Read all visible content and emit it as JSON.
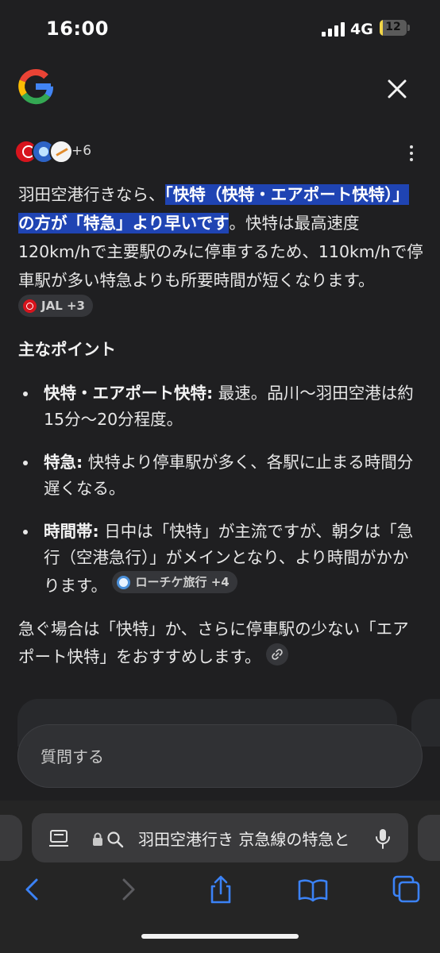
{
  "status_bar": {
    "time": "16:00",
    "network": "4G",
    "battery_level": "12",
    "battery_fraction": 0.12,
    "icons": [
      "signal-icon",
      "battery-icon"
    ]
  },
  "header": {
    "logo_icon": "google-g-logo",
    "close_icon": "close-icon"
  },
  "sources": {
    "icons": [
      "jal-icon",
      "site-icon",
      "site-icon"
    ],
    "more": "+6",
    "menu_icon": "more-vert-icon"
  },
  "answer": {
    "intro": "羽田空港行きなら、",
    "highlight": "「快特（快特・エアポート快特）」の方が「特急」より早いです",
    "rest": "。快特は最高速度120km/hで主要駅のみに停車するため、110km/hで停車駅が多い特急よりも所要時間が短くなります。",
    "citation": "JAL +3"
  },
  "points": {
    "title": "主なポイント",
    "items": [
      {
        "label": "快特・エアポート快特:",
        "text": " 最速。品川〜羽田空港は約15分〜20分程度。"
      },
      {
        "label": "特急:",
        "text": " 快特より停車駅が多く、各駅に止まる時間分遅くなる。"
      },
      {
        "label": "時間帯:",
        "text": " 日中は「快特」が主流ですが、朝夕は「急行（空港急行）」がメインとなり、より時間がかかります。",
        "citation": "ローチケ旅行 +4"
      }
    ]
  },
  "closing": {
    "text": "急ぐ場合は「快特」か、さらに停車駅の少ない「エアポート快特」をおすすめします。",
    "link_icon": "link-icon"
  },
  "ask": {
    "placeholder": "質問する"
  },
  "safari": {
    "address_text": "羽田空港行き 京急線の特急と",
    "icons": [
      "reader-icon",
      "lock-icon",
      "search-icon",
      "mic-icon",
      "back-icon",
      "forward-icon",
      "share-icon",
      "bookmarks-icon",
      "tabs-icon"
    ]
  },
  "colors": {
    "background": "#1f1f21",
    "highlight": "#1f44b3",
    "chip": "#35363a",
    "ios_blue": "#3b82f6"
  }
}
